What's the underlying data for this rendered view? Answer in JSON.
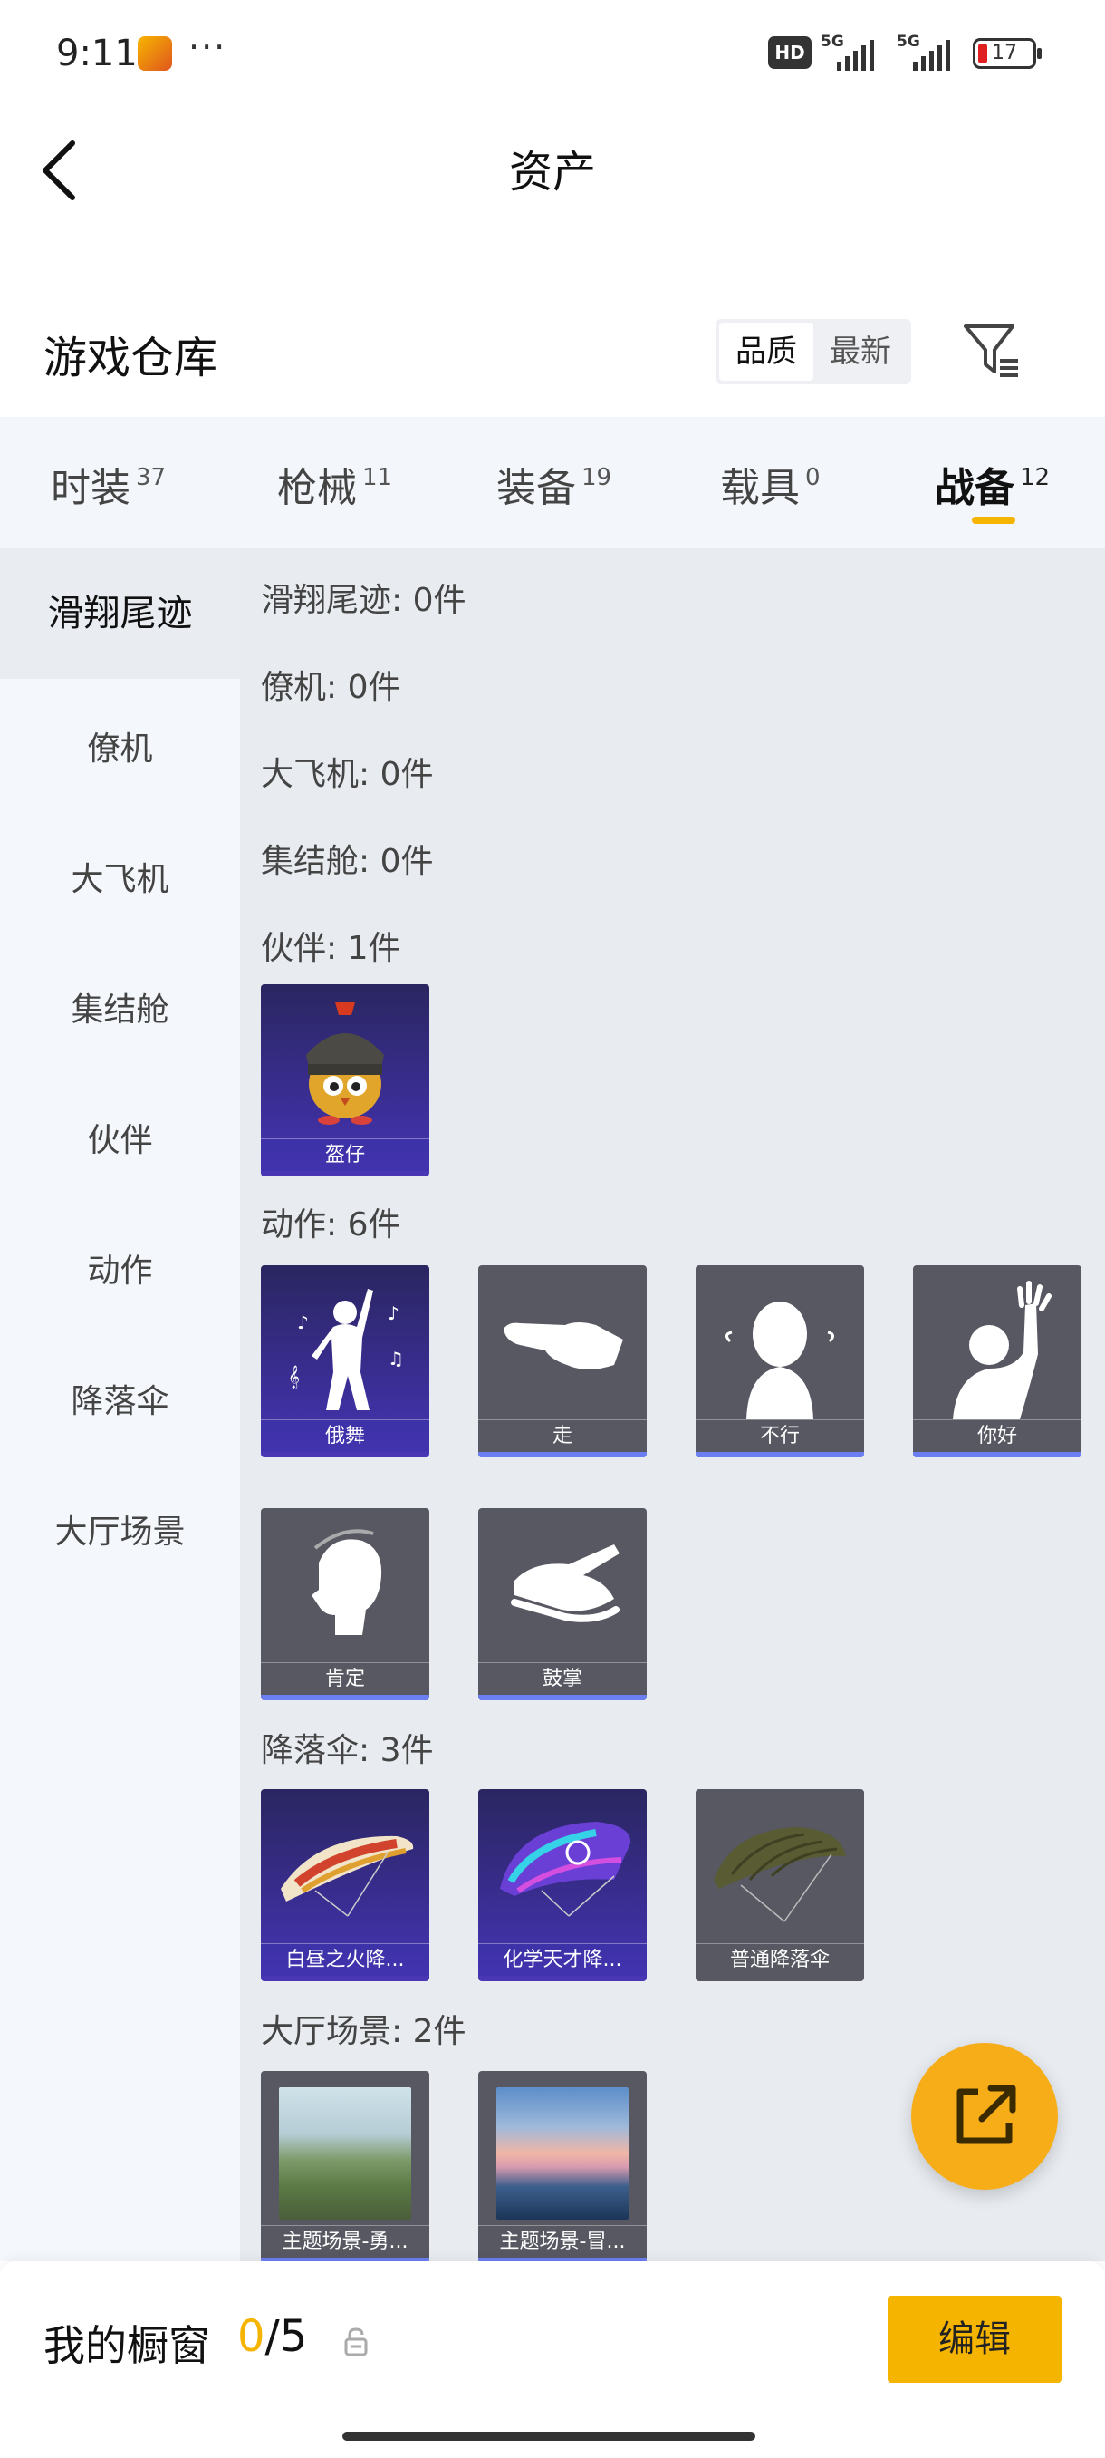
{
  "status_bar": {
    "time": "9:11",
    "battery": "17",
    "network_1": "5G",
    "network_2": "5G",
    "hd_badge": "HD"
  },
  "header": {
    "title": "资产"
  },
  "warehouse": {
    "title": "游戏仓库",
    "sort_options": [
      "品质",
      "最新"
    ],
    "active_sort": "品质"
  },
  "tabs": [
    {
      "label": "时装",
      "count": "37"
    },
    {
      "label": "枪械",
      "count": "11"
    },
    {
      "label": "装备",
      "count": "19"
    },
    {
      "label": "载具",
      "count": "0"
    },
    {
      "label": "战备",
      "count": "12",
      "active": true
    }
  ],
  "sidebar": {
    "items": [
      {
        "label": "滑翔尾迹",
        "active": true
      },
      {
        "label": "僚机"
      },
      {
        "label": "大飞机"
      },
      {
        "label": "集结舱"
      },
      {
        "label": "伙伴"
      },
      {
        "label": "动作"
      },
      {
        "label": "降落伞"
      },
      {
        "label": "大厅场景"
      }
    ]
  },
  "sections": {
    "glide_trail": "滑翔尾迹: 0件",
    "wingman": "僚机: 0件",
    "big_plane": "大飞机: 0件",
    "rally_pod": "集结舱: 0件",
    "partner": "伙伴: 1件",
    "emote": "动作: 6件",
    "parachute": "降落伞: 3件",
    "lobby_scene": "大厅场景: 2件"
  },
  "items": {
    "partner": [
      {
        "name": "盔仔"
      }
    ],
    "emote": [
      {
        "name": "俄舞"
      },
      {
        "name": "走"
      },
      {
        "name": "不行"
      },
      {
        "name": "你好"
      },
      {
        "name": "肯定"
      },
      {
        "name": "鼓掌"
      }
    ],
    "parachute": [
      {
        "name": "白昼之火降..."
      },
      {
        "name": "化学天才降..."
      },
      {
        "name": "普通降落伞"
      }
    ],
    "lobby_scene": [
      {
        "name": "主题场景-勇..."
      },
      {
        "name": "主题场景-冒..."
      }
    ]
  },
  "bottom_bar": {
    "label": "我的橱窗",
    "count_current": "0",
    "count_total": "/5",
    "edit_label": "编辑"
  },
  "colors": {
    "accent": "#f5b400",
    "rarity_purple": "#3d2f9c",
    "rarity_gray": "#575862",
    "stripe": "#6b7ef2"
  },
  "icons": [
    "back-arrow-icon",
    "filter-icon",
    "share-out-icon",
    "lock-icon"
  ]
}
